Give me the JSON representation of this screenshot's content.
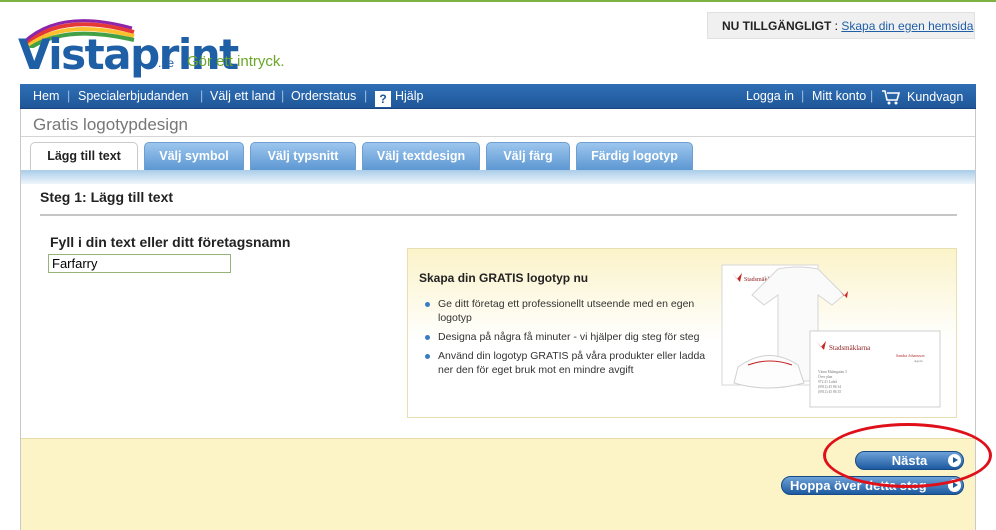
{
  "brand": {
    "logo_text": "Vistaprint",
    "domain_suffix": ".se",
    "tagline": "Gör ett intryck.",
    "primary_color": "#1f5fa6",
    "accent_color": "#6aa627"
  },
  "notice": {
    "label": "NU TILLGÄNGLIGT",
    "separator": " : ",
    "link": "Skapa din egen hemsida"
  },
  "nav": {
    "home": "Hem",
    "offers": "Specialerbjudanden",
    "country": "Välj ett land",
    "order_status": "Orderstatus",
    "help_icon": "?",
    "help": "Hjälp",
    "login": "Logga in",
    "account": "Mitt konto",
    "cart": "Kundvagn",
    "separator": "|"
  },
  "page_title": "Gratis logotypdesign",
  "tabs": [
    {
      "label": "Lägg till text",
      "active": true
    },
    {
      "label": "Välj symbol",
      "active": false
    },
    {
      "label": "Välj typsnitt",
      "active": false
    },
    {
      "label": "Välj textdesign",
      "active": false
    },
    {
      "label": "Välj färg",
      "active": false
    },
    {
      "label": "Färdig logotyp",
      "active": false
    }
  ],
  "step": {
    "heading": "Steg 1: Lägg till text",
    "field_label": "Fyll i din text eller ditt företagsnamn",
    "field_value": "Farfarry"
  },
  "promo": {
    "title": "Skapa din GRATIS logotyp nu",
    "bullets": [
      "Ge ditt företag ett professionellt utseende med en egen logotyp",
      "Designa på några få minuter - vi hjälper dig steg för steg",
      "Använd din logotyp GRATIS på våra produkter eller ladda ner den för eget bruk mot en mindre avgift"
    ],
    "sample_brand": "Stadsmäklarna",
    "sample_person": "Sandra Johansson",
    "sample_role": "Agent",
    "sample_address": [
      "Vänra Malmgatan 3",
      "Över plan",
      "972 41 Luleå",
      "(0912) 45 86 34",
      "(0912) 45 86 35"
    ]
  },
  "buttons": {
    "next": "Nästa",
    "skip": "Hoppa över detta steg"
  },
  "annotation_color": "#e0101a"
}
